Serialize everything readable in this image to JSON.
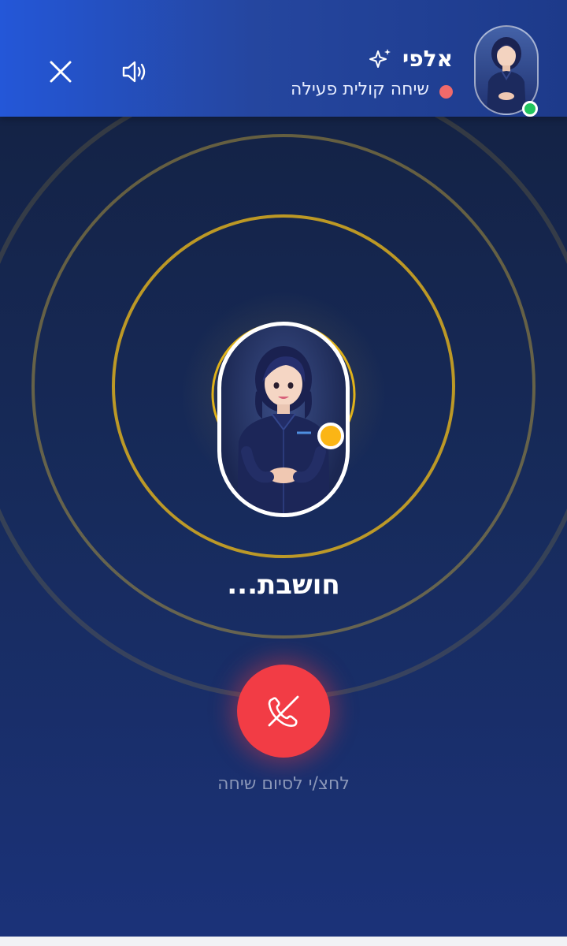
{
  "header": {
    "title": "אלפי",
    "subtitle": "שיחה קולית פעילה",
    "icons": {
      "sparkle": "sparkles-icon",
      "speaker": "speaker-icon",
      "close": "close-icon",
      "status": "status-dot",
      "online": "online-indicator"
    },
    "colors": {
      "header_bg": "#2457d8",
      "status_dot": "#f06a6a",
      "online": "#22c55e"
    }
  },
  "call": {
    "state_text": "חושבת...",
    "end_hint": "לחצ/י לסיום שיחה",
    "thinking_indicator_color": "#fbb515",
    "ring_color": "#e0b21a",
    "end_button_color": "#f23c45",
    "end_icon": "phone-hangup-icon"
  }
}
